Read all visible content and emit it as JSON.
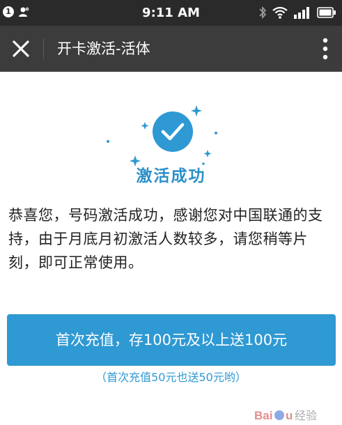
{
  "status_bar": {
    "notification_count": "1",
    "time": "9:11 AM",
    "icons": [
      "person-icon",
      "bluetooth-icon",
      "wifi-icon",
      "signal-icon",
      "battery-icon"
    ]
  },
  "app_bar": {
    "title": "开卡激活-活体",
    "icons": [
      "close-icon",
      "more-vertical-icon"
    ]
  },
  "main": {
    "success_title": "激活成功",
    "message": "恭喜您，号码激活成功，感谢您对中国联通的支持，由于月底月初激活人数较多，请您稍等片刻，即可正常使用。",
    "cta_button": "首次充值，存100元及以上送100元",
    "cta_note": "（首次充值50元也送50元哟）"
  },
  "colors": {
    "accent": "#2f99d3",
    "title_blue": "#2b8fc7",
    "app_bar": "#3c3c3c",
    "status_bar": "#2a2a2a"
  },
  "watermark_text": "Baidu经验"
}
